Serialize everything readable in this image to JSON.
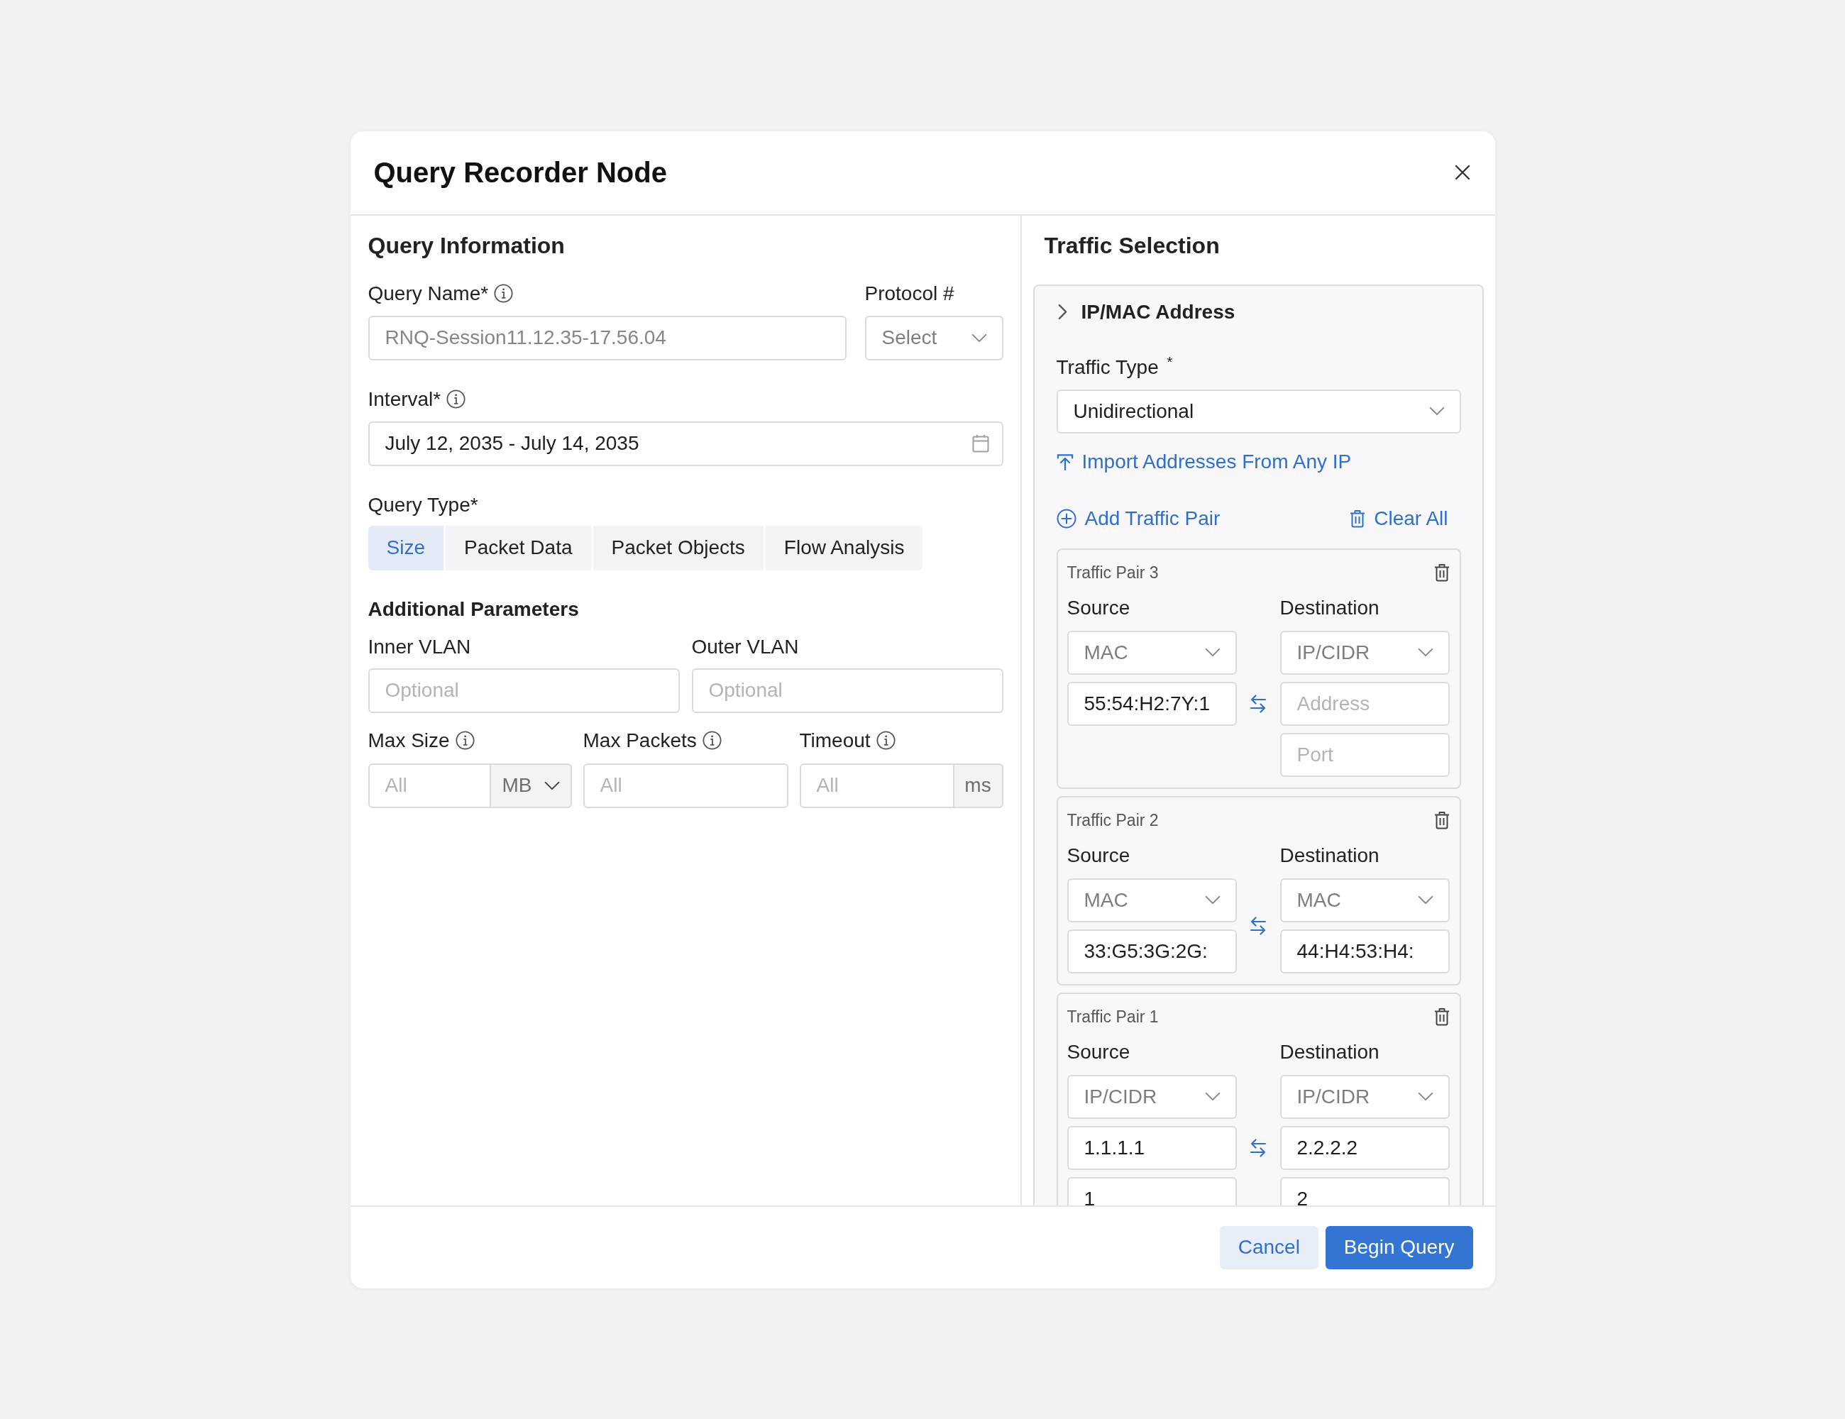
{
  "dialog": {
    "title": "Query Recorder Node"
  },
  "query_information": {
    "heading": "Query Information",
    "query_name": {
      "label": "Query Name*",
      "info": true,
      "placeholder": "RNQ-Session11.12.35-17.56.04"
    },
    "protocol": {
      "label": "Protocol #",
      "placeholder": "Select"
    },
    "interval": {
      "label": "Interval*",
      "info": true,
      "value": "July 12, 2035 - July 14, 2035"
    },
    "query_type": {
      "label": "Query Type*",
      "options": [
        {
          "label": "Size",
          "selected": true
        },
        {
          "label": "Packet Data",
          "selected": false
        },
        {
          "label": "Packet Objects",
          "selected": false
        },
        {
          "label": "Flow Analysis",
          "selected": false
        }
      ]
    }
  },
  "additional_parameters": {
    "heading": "Additional Parameters",
    "inner_vlan": {
      "label": "Inner VLAN",
      "placeholder": "Optional"
    },
    "outer_vlan": {
      "label": "Outer VLAN",
      "placeholder": "Optional"
    },
    "max_size": {
      "label": "Max Size",
      "info": true,
      "placeholder": "All",
      "unit": {
        "label": "MB",
        "kind": "dropdown"
      }
    },
    "max_packets": {
      "label": "Max Packets",
      "info": true,
      "placeholder": "All"
    },
    "timeout": {
      "label": "Timeout",
      "info": true,
      "placeholder": "All",
      "unit": {
        "label": "ms",
        "kind": "static"
      }
    }
  },
  "traffic_selection": {
    "heading": "Traffic Selection",
    "section": {
      "title": "IP/MAC Address"
    },
    "traffic_type": {
      "label": "Traffic Type $^{*}$",
      "value": "Unidirectional"
    },
    "import_link": "Import Addresses From Any IP",
    "add_pair_link": "Add Traffic Pair",
    "clear_all_link": "Clear All",
    "pairs": [
      {
        "title": "Traffic Pair 3",
        "source": {
          "label": "Source",
          "type": "MAC",
          "fields": [
            {
              "value": "55:54:H2:7Y:1"
            }
          ]
        },
        "destination": {
          "label": "Destination",
          "type": "IP/CIDR",
          "fields": [
            {
              "placeholder": "Address"
            },
            {
              "placeholder": "Port"
            }
          ]
        }
      },
      {
        "title": "Traffic Pair 2",
        "source": {
          "label": "Source",
          "type": "MAC",
          "fields": [
            {
              "value": "33:G5:3G:2G:"
            }
          ]
        },
        "destination": {
          "label": "Destination",
          "type": "MAC",
          "fields": [
            {
              "value": "44:H4:53:H4:"
            }
          ]
        }
      },
      {
        "title": "Traffic Pair 1",
        "source": {
          "label": "Source",
          "type": "IP/CIDR",
          "fields": [
            {
              "value": "1.1.1.1"
            },
            {
              "value": "1"
            }
          ]
        },
        "destination": {
          "label": "Destination",
          "type": "IP/CIDR",
          "fields": [
            {
              "value": "2.2.2.2"
            },
            {
              "value": "2"
            }
          ]
        }
      }
    ]
  },
  "footer": {
    "buttons": [
      {
        "label": "Cancel",
        "kind": "secondary"
      },
      {
        "label": "Begin Query",
        "kind": "primary"
      }
    ]
  }
}
